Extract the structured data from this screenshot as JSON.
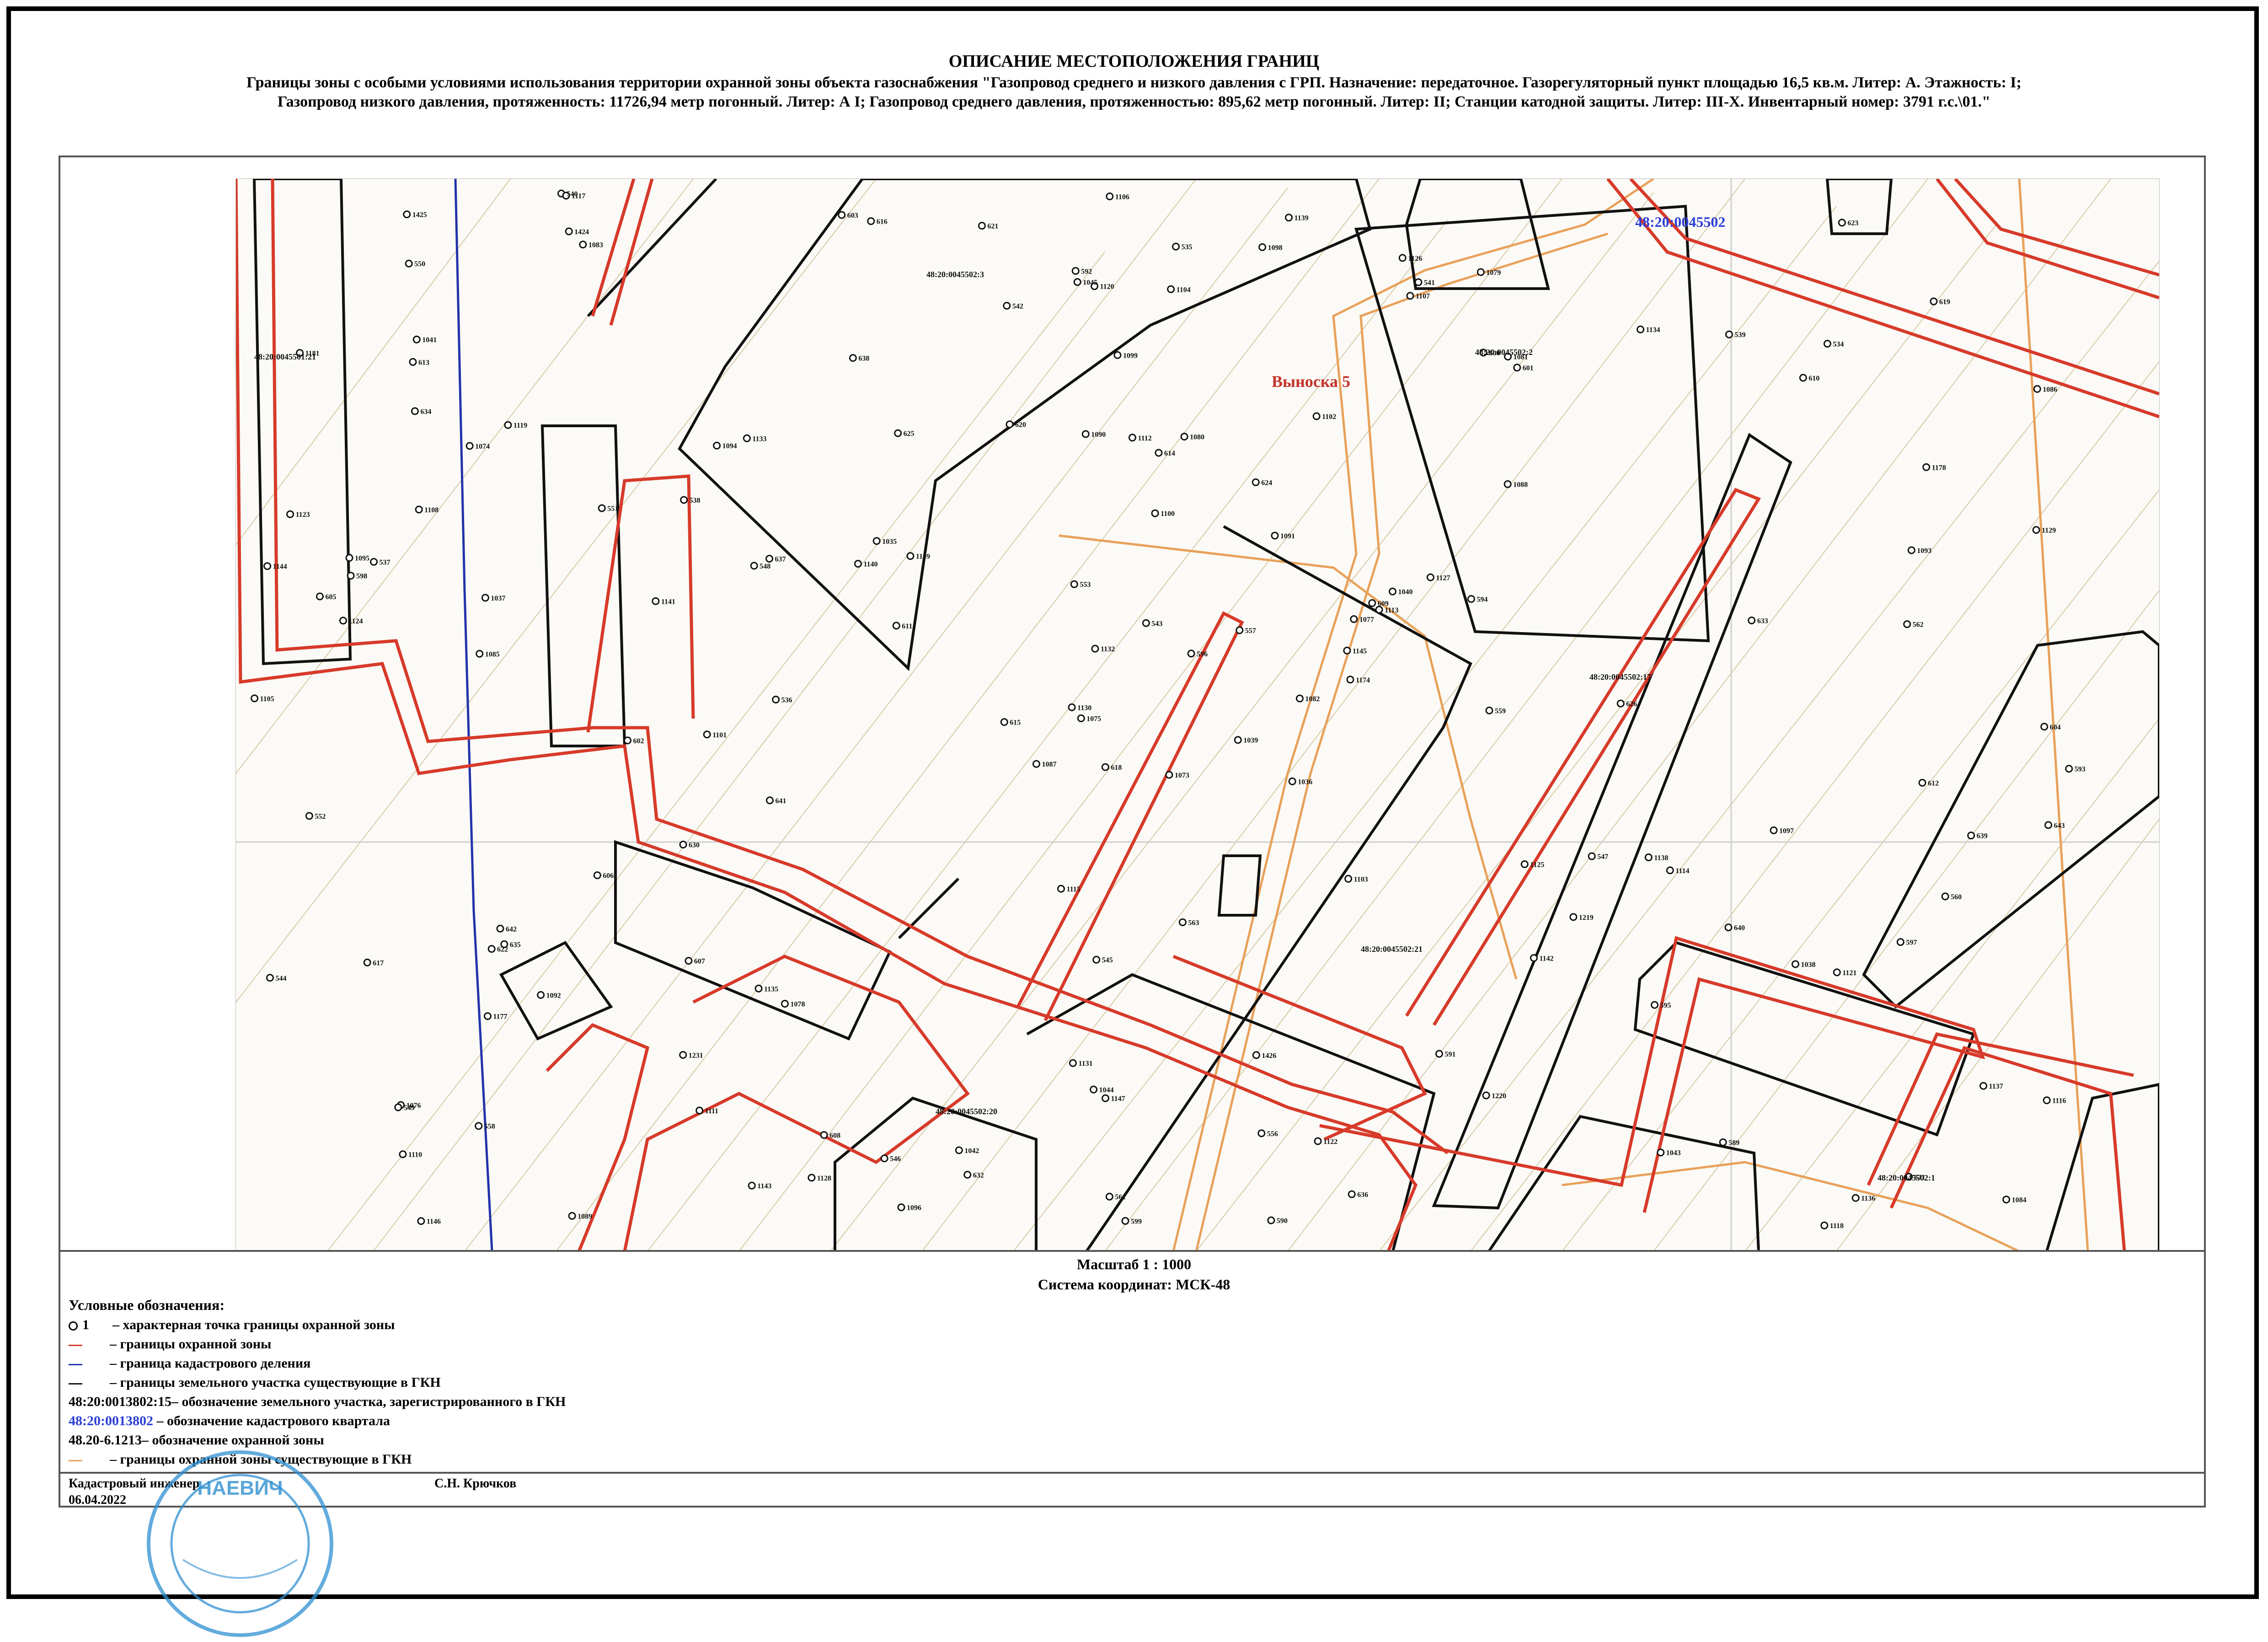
{
  "header": {
    "title": "ОПИСАНИЕ МЕСТОПОЛОЖЕНИЯ ГРАНИЦ",
    "subtitle_line1": "Границы зоны с особыми условиями использования территории охранной зоны объекта газоснабжения \"Газопровод среднего и низкого давления с ГРП. Назначение: передаточное. Газорегуляторный пункт площадью 16,5 кв.м. Литер: А. Этажность: I;",
    "subtitle_line2": "Газопровод низкого давления, протяженность: 11726,94 метр погонный. Литер: А I; Газопровод среднего давления, протяженностью: 895,62 метр погонный. Литер: II; Станции катодной защиты. Литер: III-X. Инвентарный номер: 3791 г.с.\\01.\""
  },
  "map": {
    "callout": "Выноска 5",
    "quarter_label": "48:20:0045502",
    "parcels": [
      "48:20:0045502:3",
      "48:20:0045502:2",
      "48:20:0045501:21",
      "48:20:0045502:17",
      "48:20:0045502:21",
      "48:20:0045502:20",
      "48:20:0045502:1"
    ],
    "points": [
      "1073",
      "1074",
      "1075",
      "1076",
      "1077",
      "1078",
      "1079",
      "1080",
      "1081",
      "1082",
      "1083",
      "1084",
      "1085",
      "1086",
      "1087",
      "1088",
      "1089",
      "1090",
      "1091",
      "1092",
      "1109",
      "1110",
      "1111",
      "1112",
      "1113",
      "1114",
      "1119",
      "1120",
      "1124",
      "1125",
      "1129",
      "1130",
      "1131",
      "1132",
      "1133",
      "1134",
      "1135",
      "1136",
      "1137",
      "1138",
      "1139",
      "1140",
      "1141",
      "1142",
      "1143",
      "1144",
      "1145",
      "1146",
      "1147",
      "1174",
      "1177",
      "1178",
      "1181",
      "1219",
      "1220",
      "1231",
      "1424",
      "1425",
      "1426",
      "534",
      "535",
      "536",
      "537",
      "538",
      "539",
      "540",
      "541",
      "542",
      "543",
      "544",
      "545",
      "546",
      "547",
      "548",
      "549",
      "550",
      "551",
      "552",
      "553",
      "556",
      "557",
      "558",
      "559",
      "560",
      "561",
      "562",
      "563",
      "589",
      "590",
      "591",
      "592",
      "593",
      "594",
      "595",
      "596",
      "597",
      "598",
      "599",
      "600",
      "601",
      "602",
      "603",
      "604",
      "605",
      "606",
      "607",
      "608",
      "609",
      "610",
      "611",
      "612",
      "613",
      "614",
      "615",
      "616",
      "617",
      "618",
      "619",
      "620",
      "621",
      "622",
      "623",
      "624",
      "625",
      "626",
      "630",
      "631",
      "632",
      "633",
      "634",
      "635",
      "636",
      "637",
      "638",
      "639",
      "640",
      "641",
      "642",
      "643",
      "1035",
      "1036",
      "1037",
      "1038",
      "1039",
      "1040",
      "1041",
      "1042",
      "1043",
      "1044",
      "1045",
      "1093",
      "1094",
      "1095",
      "1096",
      "1097",
      "1098",
      "1099",
      "1100",
      "1101",
      "1102",
      "1103",
      "1104",
      "1105",
      "1106",
      "1107",
      "1108",
      "1115",
      "1116",
      "1117",
      "1118",
      "1121",
      "1122",
      "1123",
      "1126",
      "1127",
      "1128"
    ]
  },
  "scale": {
    "scale_text": "Масштаб 1 :  1000",
    "crs_text": "Система координат: МСК-48"
  },
  "legend": {
    "title": "Условные обозначения:",
    "point_number": "1",
    "items": [
      {
        "text": "– характерная точка границы  охранной зоны"
      },
      {
        "text": "– границы охранной зоны",
        "color": "#d73a2a"
      },
      {
        "text": "– граница кадастрового деления",
        "color": "#2233aa"
      },
      {
        "text": "– границы земельного участка существующие в ГКН",
        "color": "#111111"
      }
    ],
    "parcel_example": "48:20:0013802:15",
    "parcel_desc": "– обозначение земельного участка, зарегистрированного в ГКН",
    "quarter_example": "48:20:0013802",
    "quarter_color": "#2b3fd6",
    "quarter_desc": "– обозначение кадастрового квартала",
    "zone_example": "48.20-6.1213",
    "zone_desc": "– обозначение охранной зоны",
    "zone_existing_desc": "– границы охранной зоны существующие в ГКН",
    "zone_existing_color": "#e8a15a"
  },
  "footer": {
    "engineer_label": "Кадастровый инженер",
    "engineer_name": "С.Н. Крючков",
    "date": "06.04.2022"
  },
  "stamp": {
    "text_top": "НАЕВИЧ",
    "color": "#2f8fd0"
  }
}
